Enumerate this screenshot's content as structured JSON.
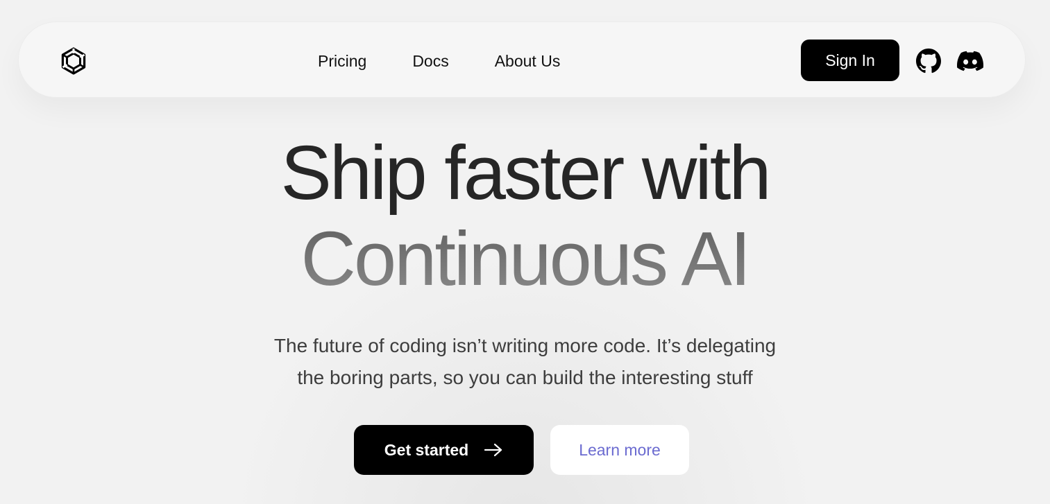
{
  "nav": {
    "logo_icon": "hexagon-logo-icon",
    "links": [
      {
        "label": "Pricing"
      },
      {
        "label": "Docs"
      },
      {
        "label": "About Us"
      }
    ],
    "signin_label": "Sign In",
    "github_icon": "github-icon",
    "discord_icon": "discord-icon"
  },
  "hero": {
    "title_line1": "Ship faster with",
    "title_line2": "Continuous AI",
    "subtitle_line1": "The future of coding isn’t writing more code. It’s delegating",
    "subtitle_line2": "the boring parts, so you can build the interesting stuff",
    "primary_cta": "Get started",
    "primary_cta_icon": "arrow-right-icon",
    "secondary_cta": "Learn more"
  },
  "colors": {
    "background": "#f2f2f2",
    "primary_button": "#000000",
    "secondary_button_text": "#6b6bd0",
    "title_dark": "#262626",
    "title_gray": "#7a7a7a"
  }
}
